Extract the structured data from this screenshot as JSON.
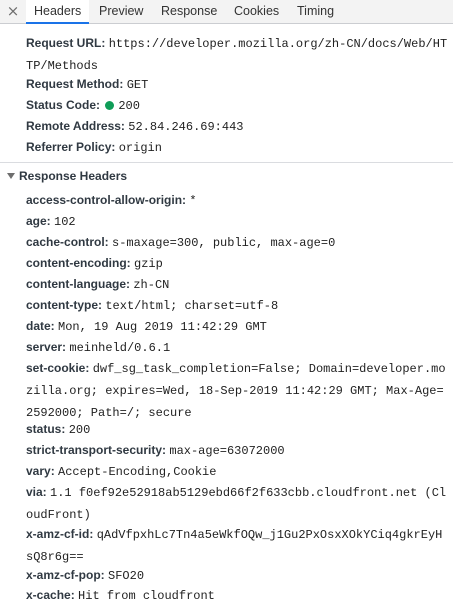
{
  "tabs": {
    "close": "×",
    "items": [
      "Headers",
      "Preview",
      "Response",
      "Cookies",
      "Timing"
    ]
  },
  "general": {
    "request_url": {
      "label": "Request URL:",
      "value": "https://developer.mozilla.org/zh-CN/docs/Web/HTTP/Methods"
    },
    "request_method": {
      "label": "Request Method:",
      "value": "GET"
    },
    "status_code": {
      "label": "Status Code:",
      "value": "200",
      "status_color": "#0f9d58"
    },
    "remote_address": {
      "label": "Remote Address:",
      "value": "52.84.246.69:443"
    },
    "referrer_policy": {
      "label": "Referrer Policy:",
      "value": "origin"
    }
  },
  "response_headers": {
    "title": "Response Headers",
    "items": [
      {
        "name": "access-control-allow-origin:",
        "value": "*"
      },
      {
        "name": "age:",
        "value": "102"
      },
      {
        "name": "cache-control:",
        "value": "s-maxage=300, public, max-age=0"
      },
      {
        "name": "content-encoding:",
        "value": "gzip"
      },
      {
        "name": "content-language:",
        "value": "zh-CN"
      },
      {
        "name": "content-type:",
        "value": "text/html; charset=utf-8"
      },
      {
        "name": "date:",
        "value": "Mon, 19 Aug 2019 11:42:29 GMT"
      },
      {
        "name": "server:",
        "value": "meinheld/0.6.1"
      },
      {
        "name": "set-cookie:",
        "value": "dwf_sg_task_completion=False; Domain=developer.mozilla.org; expires=Wed, 18-Sep-2019 11:42:29 GMT; Max-Age=2592000; Path=/; secure"
      },
      {
        "name": "status:",
        "value": "200"
      },
      {
        "name": "strict-transport-security:",
        "value": "max-age=63072000"
      },
      {
        "name": "vary:",
        "value": "Accept-Encoding,Cookie"
      },
      {
        "name": "via:",
        "value": "1.1 f0ef92e52918ab5129ebd66f2f633cbb.cloudfront.net (CloudFront)"
      },
      {
        "name": "x-amz-cf-id:",
        "value": "qAdVfpxhLc7Tn4a5eWkfOQw_j1Gu2PxOsxXOkYCiq4gkrEyHsQ8r6g=="
      },
      {
        "name": "x-amz-cf-pop:",
        "value": "SFO20"
      },
      {
        "name": "x-cache:",
        "value": "Hit from cloudfront"
      }
    ]
  }
}
